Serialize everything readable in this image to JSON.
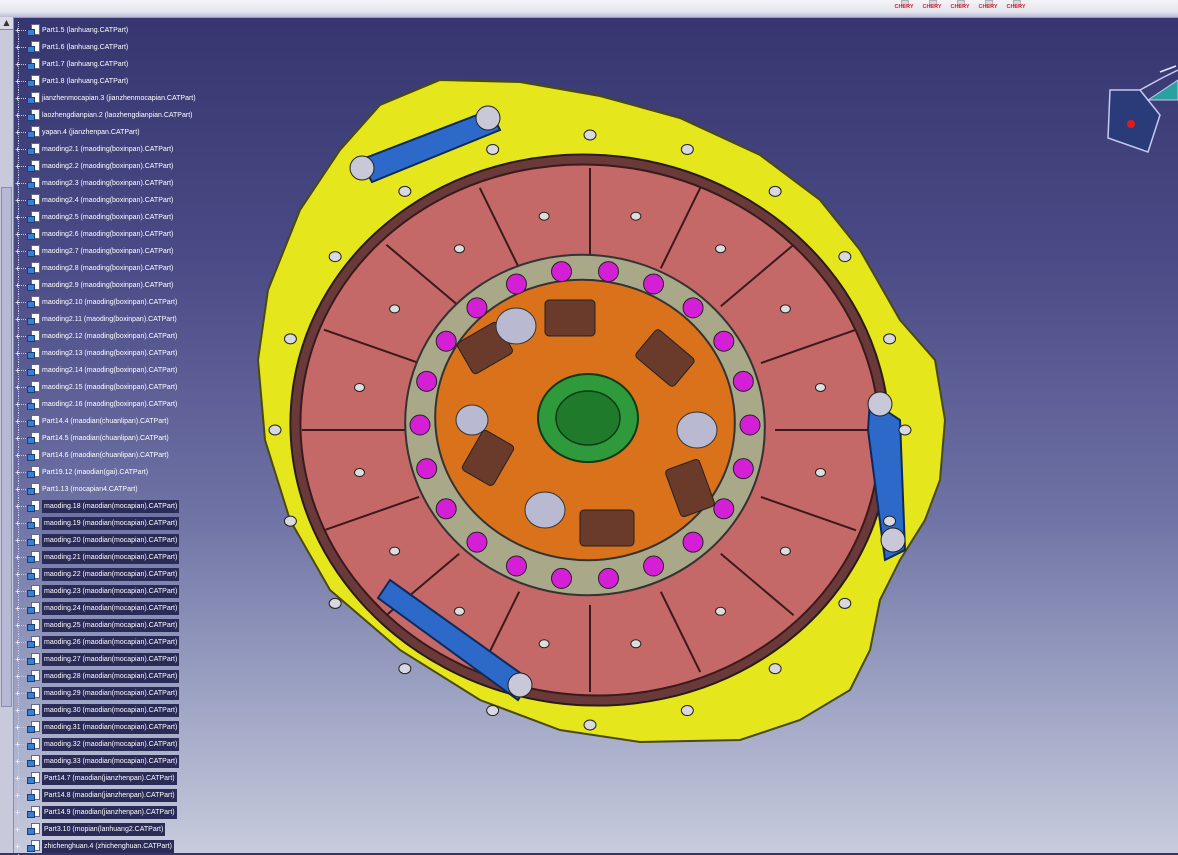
{
  "brands": [
    "CHERY",
    "CHERY",
    "CHERY",
    "CHERY",
    "CHERY"
  ],
  "tree_items": [
    {
      "label": "Part1.5 (lanhuang.CATPart)",
      "hl": false
    },
    {
      "label": "Part1.6 (lanhuang.CATPart)",
      "hl": false
    },
    {
      "label": "Part1.7 (lanhuang.CATPart)",
      "hl": false
    },
    {
      "label": "Part1.8 (lanhuang.CATPart)",
      "hl": false
    },
    {
      "label": "jianzhenmocapian.3 (jianzhenmocapian.CATPart)",
      "hl": false
    },
    {
      "label": "laozhengdianpian.2 (laozhengdianpian.CATPart)",
      "hl": false
    },
    {
      "label": "yapan.4 (jianzhenpan.CATPart)",
      "hl": false
    },
    {
      "label": "maoding2.1 (maoding(boxinpan).CATPart)",
      "hl": false
    },
    {
      "label": "maoding2.2 (maoding(boxinpan).CATPart)",
      "hl": false
    },
    {
      "label": "maoding2.3 (maoding(boxinpan).CATPart)",
      "hl": false
    },
    {
      "label": "maoding2.4 (maoding(boxinpan).CATPart)",
      "hl": false
    },
    {
      "label": "maoding2.5 (maoding(boxinpan).CATPart)",
      "hl": false
    },
    {
      "label": "maoding2.6 (maoding(boxinpan).CATPart)",
      "hl": false
    },
    {
      "label": "maoding2.7 (maoding(boxinpan).CATPart)",
      "hl": false
    },
    {
      "label": "maoding2.8 (maoding(boxinpan).CATPart)",
      "hl": false
    },
    {
      "label": "maoding2.9 (maoding(boxinpan).CATPart)",
      "hl": false
    },
    {
      "label": "maoding2.10 (maoding(boxinpan).CATPart)",
      "hl": false
    },
    {
      "label": "maoding2.11 (maoding(boxinpan).CATPart)",
      "hl": false
    },
    {
      "label": "maoding2.12 (maoding(boxinpan).CATPart)",
      "hl": false
    },
    {
      "label": "maoding2.13 (maoding(boxinpan).CATPart)",
      "hl": false
    },
    {
      "label": "maoding2.14 (maoding(boxinpan).CATPart)",
      "hl": false
    },
    {
      "label": "maoding2.15 (maoding(boxinpan).CATPart)",
      "hl": false
    },
    {
      "label": "maoding2.16 (maoding(boxinpan).CATPart)",
      "hl": false
    },
    {
      "label": "Part14.4 (maodian(chuanlipan).CATPart)",
      "hl": false
    },
    {
      "label": "Part14.5 (maodian(chuanlipan).CATPart)",
      "hl": false
    },
    {
      "label": "Part14.6 (maodian(chuanlipan).CATPart)",
      "hl": false
    },
    {
      "label": "Part19.12 (maodian(gai).CATPart)",
      "hl": false
    },
    {
      "label": "Part1.13 (mocapian4.CATPart)",
      "hl": false
    },
    {
      "label": "maoding.18 (maodian(mocapian).CATPart)",
      "hl": true
    },
    {
      "label": "maoding.19 (maodian(mocapian).CATPart)",
      "hl": true
    },
    {
      "label": "maoding.20 (maodian(mocapian).CATPart)",
      "hl": true
    },
    {
      "label": "maoding.21 (maodian(mocapian).CATPart)",
      "hl": true
    },
    {
      "label": "maoding.22 (maodian(mocapian).CATPart)",
      "hl": true
    },
    {
      "label": "maoding.23 (maodian(mocapian).CATPart)",
      "hl": true
    },
    {
      "label": "maoding.24 (maodian(mocapian).CATPart)",
      "hl": true
    },
    {
      "label": "maoding.25 (maodian(mocapian).CATPart)",
      "hl": true
    },
    {
      "label": "maoding.26 (maodian(mocapian).CATPart)",
      "hl": true
    },
    {
      "label": "maoding.27 (maodian(mocapian).CATPart)",
      "hl": true
    },
    {
      "label": "maoding.28 (maodian(mocapian).CATPart)",
      "hl": true
    },
    {
      "label": "maoding.29 (maodian(mocapian).CATPart)",
      "hl": true
    },
    {
      "label": "maoding.30 (maodian(mocapian).CATPart)",
      "hl": true
    },
    {
      "label": "maoding.31 (maodian(mocapian).CATPart)",
      "hl": true
    },
    {
      "label": "maoding.32 (maodian(mocapian).CATPart)",
      "hl": true
    },
    {
      "label": "maoding.33 (maodian(mocapian).CATPart)",
      "hl": true
    },
    {
      "label": "Part14.7 (maodian(jianzhenpan).CATPart)",
      "hl": true
    },
    {
      "label": "Part14.8 (maodian(jianzhenpan).CATPart)",
      "hl": true
    },
    {
      "label": "Part14.9 (maodian(jianzhenpan).CATPart)",
      "hl": true
    },
    {
      "label": "Part3.10 (mopian(lanhuang2.CATPart)",
      "hl": true
    },
    {
      "label": "zhichenghuan.4 (zhichenghuan.CATPart)",
      "hl": true
    }
  ],
  "colors": {
    "cover_yellow": "#e6e61c",
    "friction_pink": "#c46868",
    "hub_orange": "#d9721a",
    "spline_green": "#2e9a3c",
    "rivet_magenta": "#d41fd6",
    "strap_blue": "#2c69c8",
    "ring_gray": "#a9a98a"
  },
  "icons": [
    "part-icon",
    "expand-icon",
    "compass-icon",
    "scroll-up-icon"
  ]
}
